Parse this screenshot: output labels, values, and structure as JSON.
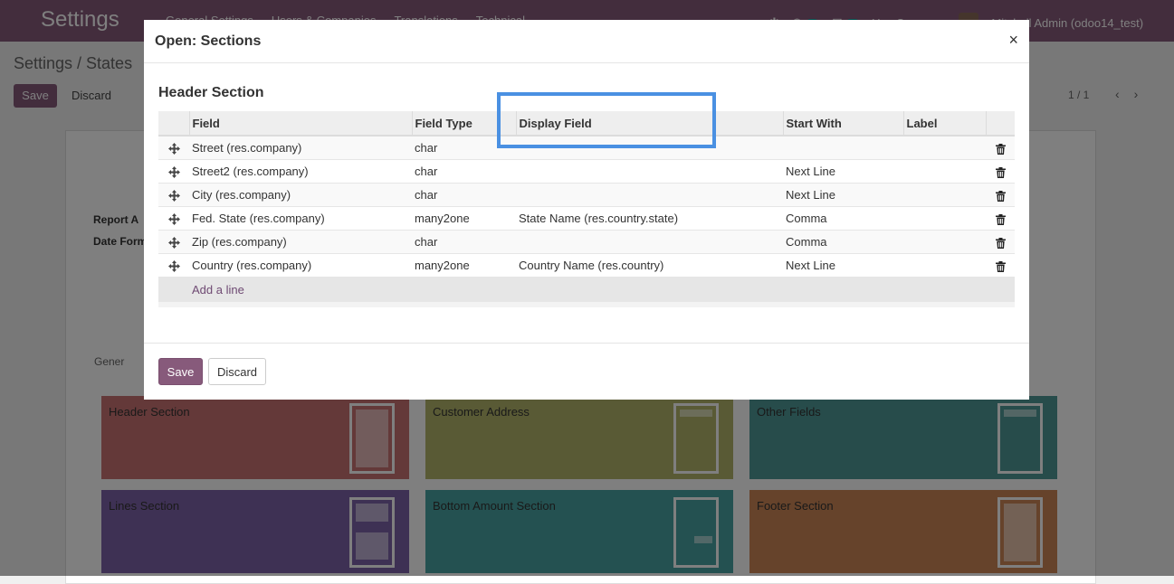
{
  "background": {
    "app_title": "Settings",
    "menu": [
      "General Settings",
      "Users & Companies",
      "Translations",
      "Technical"
    ],
    "navbar_badges": [
      "1",
      "4"
    ],
    "company": "YourCompany",
    "user": "Mitchell Admin (odoo14_test)",
    "breadcrumb": "Settings / States",
    "save_label": "Save",
    "discard_label": "Discard",
    "pager": "1 / 1",
    "report_label": "Report A",
    "date_label": "Date Form",
    "side_text": "e",
    "tab_label": "Gener",
    "cards": [
      {
        "title": "Header Section",
        "color": "#c97372"
      },
      {
        "title": "Customer Address",
        "color": "#b2b56a"
      },
      {
        "title": "Other Fields",
        "color": "#4e9996"
      },
      {
        "title": "Lines Section",
        "color": "#7d62a8"
      },
      {
        "title": "Bottom Amount Section",
        "color": "#48a3a2"
      },
      {
        "title": "Footer Section",
        "color": "#cc8757"
      }
    ]
  },
  "modal": {
    "title": "Open: Sections",
    "close_symbol": "×",
    "section_title": "Header Section",
    "columns": {
      "field": "Field",
      "field_type": "Field Type",
      "display_field": "Display Field",
      "start_with": "Start With",
      "label": "Label"
    },
    "rows": [
      {
        "field": "Street (res.company)",
        "field_type": "char",
        "display_field": "",
        "start_with": "",
        "label": ""
      },
      {
        "field": "Street2 (res.company)",
        "field_type": "char",
        "display_field": "",
        "start_with": "Next Line",
        "label": ""
      },
      {
        "field": "City (res.company)",
        "field_type": "char",
        "display_field": "",
        "start_with": "Next Line",
        "label": ""
      },
      {
        "field": "Fed. State (res.company)",
        "field_type": "many2one",
        "display_field": "State Name (res.country.state)",
        "start_with": "Comma",
        "label": ""
      },
      {
        "field": "Zip (res.company)",
        "field_type": "char",
        "display_field": "",
        "start_with": "Comma",
        "label": ""
      },
      {
        "field": "Country (res.company)",
        "field_type": "many2one",
        "display_field": "Country Name (res.country)",
        "start_with": "Next Line",
        "label": ""
      }
    ],
    "add_line": "Add a line",
    "save_label": "Save",
    "discard_label": "Discard"
  },
  "colors": {
    "primary": "#875a7b",
    "highlight": "#4a90e2",
    "link": "#6f4a73"
  }
}
